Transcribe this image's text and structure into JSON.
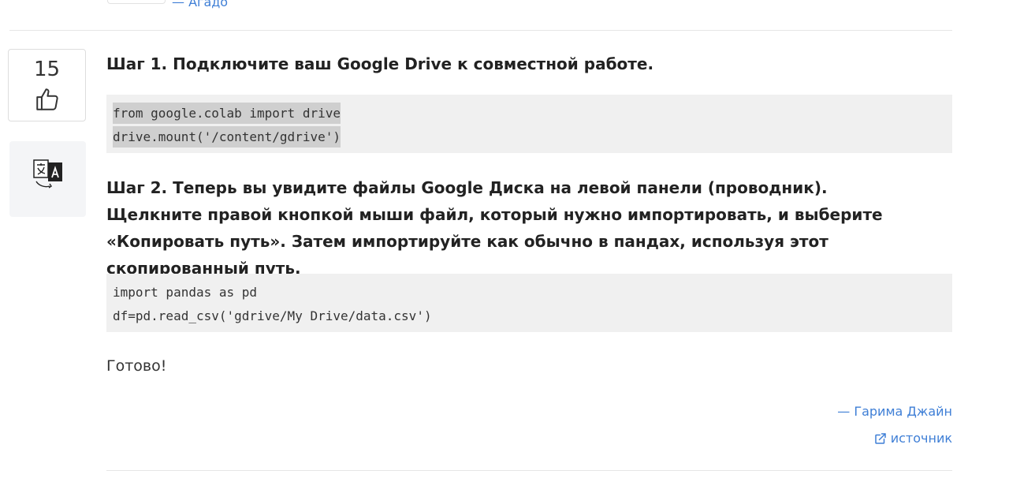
{
  "previous_answer": {
    "author": "— Агадо"
  },
  "answer": {
    "vote_count": "15",
    "step1": "Шаг 1. Подключите ваш Google Drive к совместной работе.",
    "code1": [
      "from google.colab import drive",
      "drive.mount('/content/gdrive')"
    ],
    "step2": "Шаг 2. Теперь вы увидите файлы Google Диска на левой панели (проводник). Щелкните правой кнопкой мыши файл, который нужно импортировать, и выберите «Копировать путь». Затем импортируйте как обычно в пандах, используя этот скопированный путь.",
    "code2": [
      "import pandas as pd",
      "df=pd.read_csv('gdrive/My Drive/data.csv')"
    ],
    "done": "Готово!",
    "author": "— Гарима Джайн",
    "source_label": "источник"
  },
  "colors": {
    "link": "#3f7fd6",
    "code_bg": "#f0f0f0",
    "highlight": "#cfcfcf"
  },
  "icons": {
    "vote": "thumbs-up-icon",
    "translate": "translate-icon",
    "source": "external-link-icon"
  }
}
